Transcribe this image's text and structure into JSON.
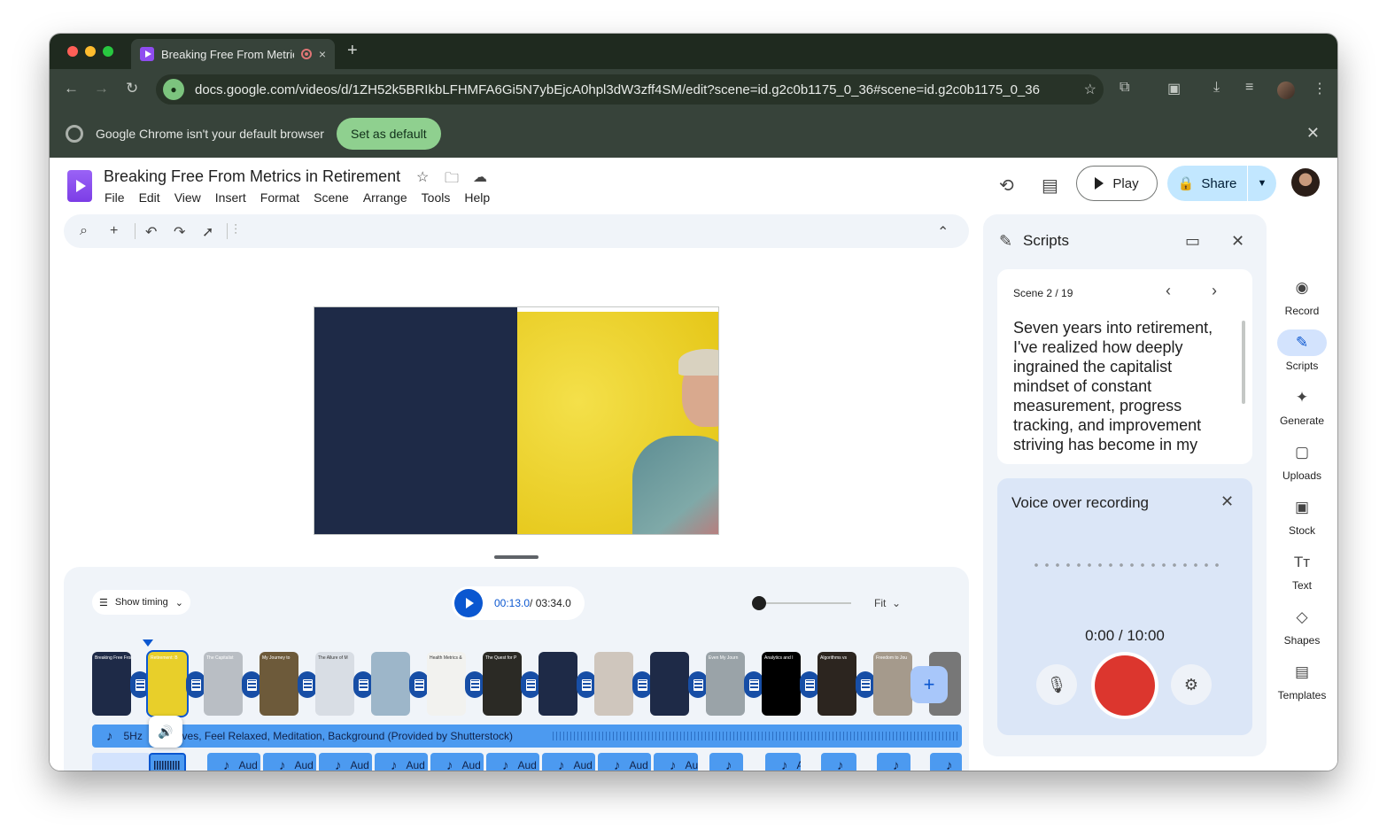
{
  "browser": {
    "tab_title": "Breaking Free From Metric",
    "tab_close": "×",
    "new_tab": "+",
    "url": "docs.google.com/videos/d/1ZH52k5BRIkbLFHMFA6Gi5N7ybEjcA0hpl3dW3zff4SM/edit?scene=id.g2c0b1175_0_36#scene=id.g2c0b1175_0_36",
    "infobar_text": "Google Chrome isn't your default browser",
    "set_default_label": "Set as default",
    "colors": {
      "frame": "#1f2a1f",
      "toolbar": "#37433a",
      "accent_green": "#8fd08f"
    }
  },
  "app": {
    "doc_title": "Breaking Free From Metrics in Retirement",
    "menu": [
      "File",
      "Edit",
      "View",
      "Insert",
      "Format",
      "Scene",
      "Arrange",
      "Tools",
      "Help"
    ],
    "play_label": "Play",
    "share_label": "Share",
    "colors": {
      "brand": "#8f4cf0",
      "primary": "#0b57d0",
      "share_bg": "#c2e7ff",
      "record_red": "#dc362e"
    }
  },
  "timeline": {
    "show_timing_label": "Show timing",
    "time_current": "00:13.0",
    "time_total": " / 03:34.0",
    "zoom_label": "Fit",
    "scene_labels": [
      "Breaking Free From Metric",
      "Retirement: B",
      "The Capitalist",
      "My Journey to",
      "The Allure of M",
      "",
      "Health Metrics &",
      "The Quest for P",
      "",
      "",
      "",
      "Even My Journ",
      "Analytics and I",
      "Algorithms vs",
      "Freedom to Jou",
      ""
    ],
    "music_label": "5Hz...aves, Feel Relaxed, Meditation, Background (Provided by Shutterstock)",
    "music_label_left": "5Hz",
    "music_label_right": "aves, Feel Relaxed, Meditation, Background (Provided by Shutterstock)",
    "audio_clip_label": "Aud",
    "audio_clip_label_short": "Au",
    "audio_clip_label_tiny": "A"
  },
  "scripts": {
    "title": "Scripts",
    "scene_counter": "Scene 2 / 19",
    "script_text": "Seven years into retirement, I've realized how deeply ingrained the capitalist mindset of constant measurement, progress tracking, and improvement striving has become in my",
    "vo_title": "Voice over recording",
    "vo_time": "0:00 / 10:00"
  },
  "rail": {
    "items": [
      {
        "label": "Record",
        "icon": "record-icon"
      },
      {
        "label": "Scripts",
        "icon": "scripts-icon"
      },
      {
        "label": "Generate",
        "icon": "generate-icon"
      },
      {
        "label": "Uploads",
        "icon": "folder-icon"
      },
      {
        "label": "Stock",
        "icon": "stock-image-icon"
      },
      {
        "label": "Text",
        "icon": "text-icon"
      },
      {
        "label": "Shapes",
        "icon": "shapes-icon"
      },
      {
        "label": "Templates",
        "icon": "templates-icon"
      }
    ]
  }
}
